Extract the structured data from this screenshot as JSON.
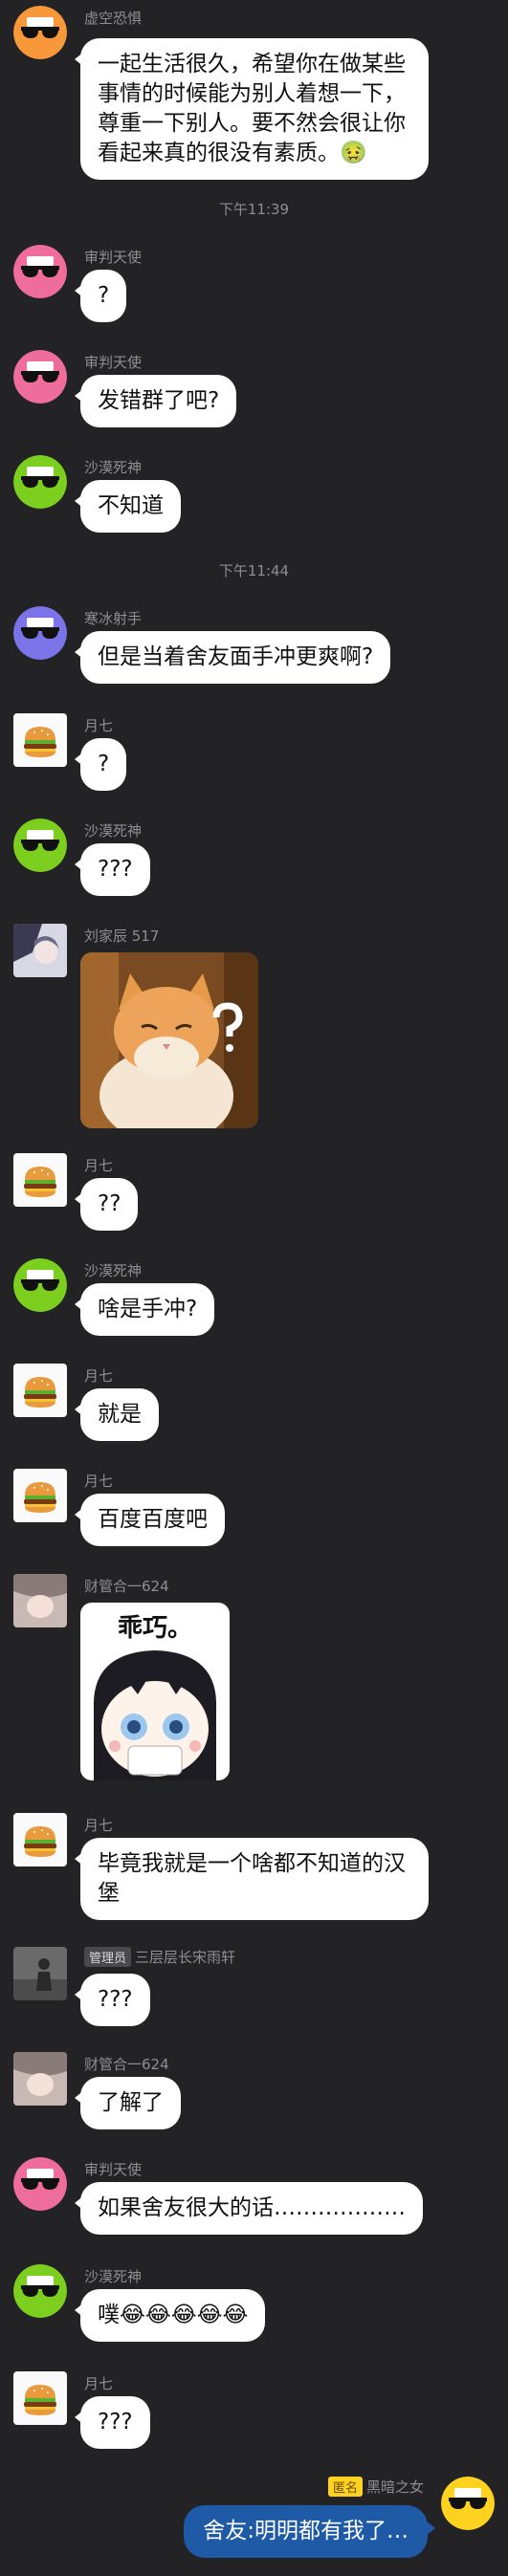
{
  "messages": [
    {
      "name": "虚空恐惧",
      "text": "一起生活很久，希望你在做某些事情的时候能为别人着想一下，尊重一下别人。要不然会很让你看起来真的很没有素质。🤢"
    },
    {
      "name": "审判天使",
      "text": "?"
    },
    {
      "name": "审判天使",
      "text": "发错群了吧?"
    },
    {
      "name": "沙漠死神",
      "text": "不知道"
    },
    {
      "name": "寒冰射手",
      "text": "但是当着舍友面手冲更爽啊?"
    },
    {
      "name": "月七",
      "text": "?"
    },
    {
      "name": "沙漠死神",
      "text": "???"
    },
    {
      "name": "刘家辰 517",
      "image": "cat-photo"
    },
    {
      "name": "月七",
      "text": "??"
    },
    {
      "name": "沙漠死神",
      "text": "啥是手冲?"
    },
    {
      "name": "月七",
      "text": "就是"
    },
    {
      "name": "月七",
      "text": "百度百度吧"
    },
    {
      "name": "财管合一624",
      "image": "anime-sticker",
      "sticker_text": "乖巧。"
    },
    {
      "name": "月七",
      "text": "毕竟我就是一个啥都不知道的汉堡"
    },
    {
      "badge": "管理员",
      "name": "三层层长宋雨轩",
      "text": "???"
    },
    {
      "name": "财管合一624",
      "text": "了解了"
    },
    {
      "name": "审判天使",
      "text": "如果舍友很大的话………………"
    },
    {
      "name": "沙漠死神",
      "text": "噗😂😂😂😂😂"
    },
    {
      "name": "月七",
      "text": "???"
    }
  ],
  "timestamps": [
    "下午11:39",
    "下午11:44"
  ],
  "self_message": {
    "badge": "匿名",
    "name": "黑暗之女",
    "text": "舍友:明明都有我了…"
  },
  "colors": {
    "background": "#232326",
    "bubble": "#ffffff",
    "self_bubble": "#1f5aa6",
    "anon_badge": "#ffd21f"
  }
}
